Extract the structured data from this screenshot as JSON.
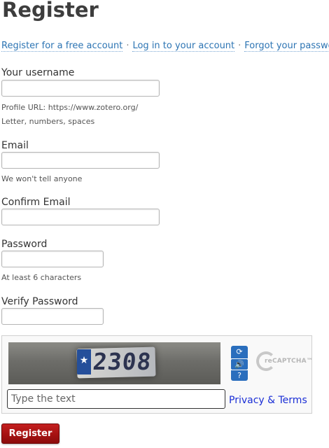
{
  "page": {
    "title": "Register"
  },
  "nav": {
    "links": [
      {
        "label": "Register for a free account"
      },
      {
        "label": "Log in to your account"
      },
      {
        "label": "Forgot your password?"
      }
    ],
    "separator": "·"
  },
  "form": {
    "username": {
      "label": "Your username",
      "value": "",
      "hint_url": "Profile URL: https://www.zotero.org/",
      "hint_rules": "Letter, numbers, spaces"
    },
    "email": {
      "label": "Email",
      "value": "",
      "hint": "We won't tell anyone"
    },
    "confirm_email": {
      "label": "Confirm Email",
      "value": ""
    },
    "password": {
      "label": "Password",
      "value": "",
      "hint": "At least 6 characters"
    },
    "verify_password": {
      "label": "Verify Password",
      "value": ""
    },
    "captcha": {
      "image_text": "2308",
      "input_placeholder": "Type the text",
      "input_value": "",
      "privacy_label": "Privacy & Terms",
      "logo_text": "reCAPTCHA™",
      "refresh_icon": "refresh-icon",
      "audio_icon": "audio-icon",
      "help_icon": "help-icon"
    },
    "submit_label": "Register"
  },
  "colors": {
    "link": "#2c74b3",
    "privacy_link": "#1a2ed6",
    "submit_button": "#a51212",
    "captcha_buttons": "#2a6ebd",
    "title": "#3d3d3d"
  }
}
